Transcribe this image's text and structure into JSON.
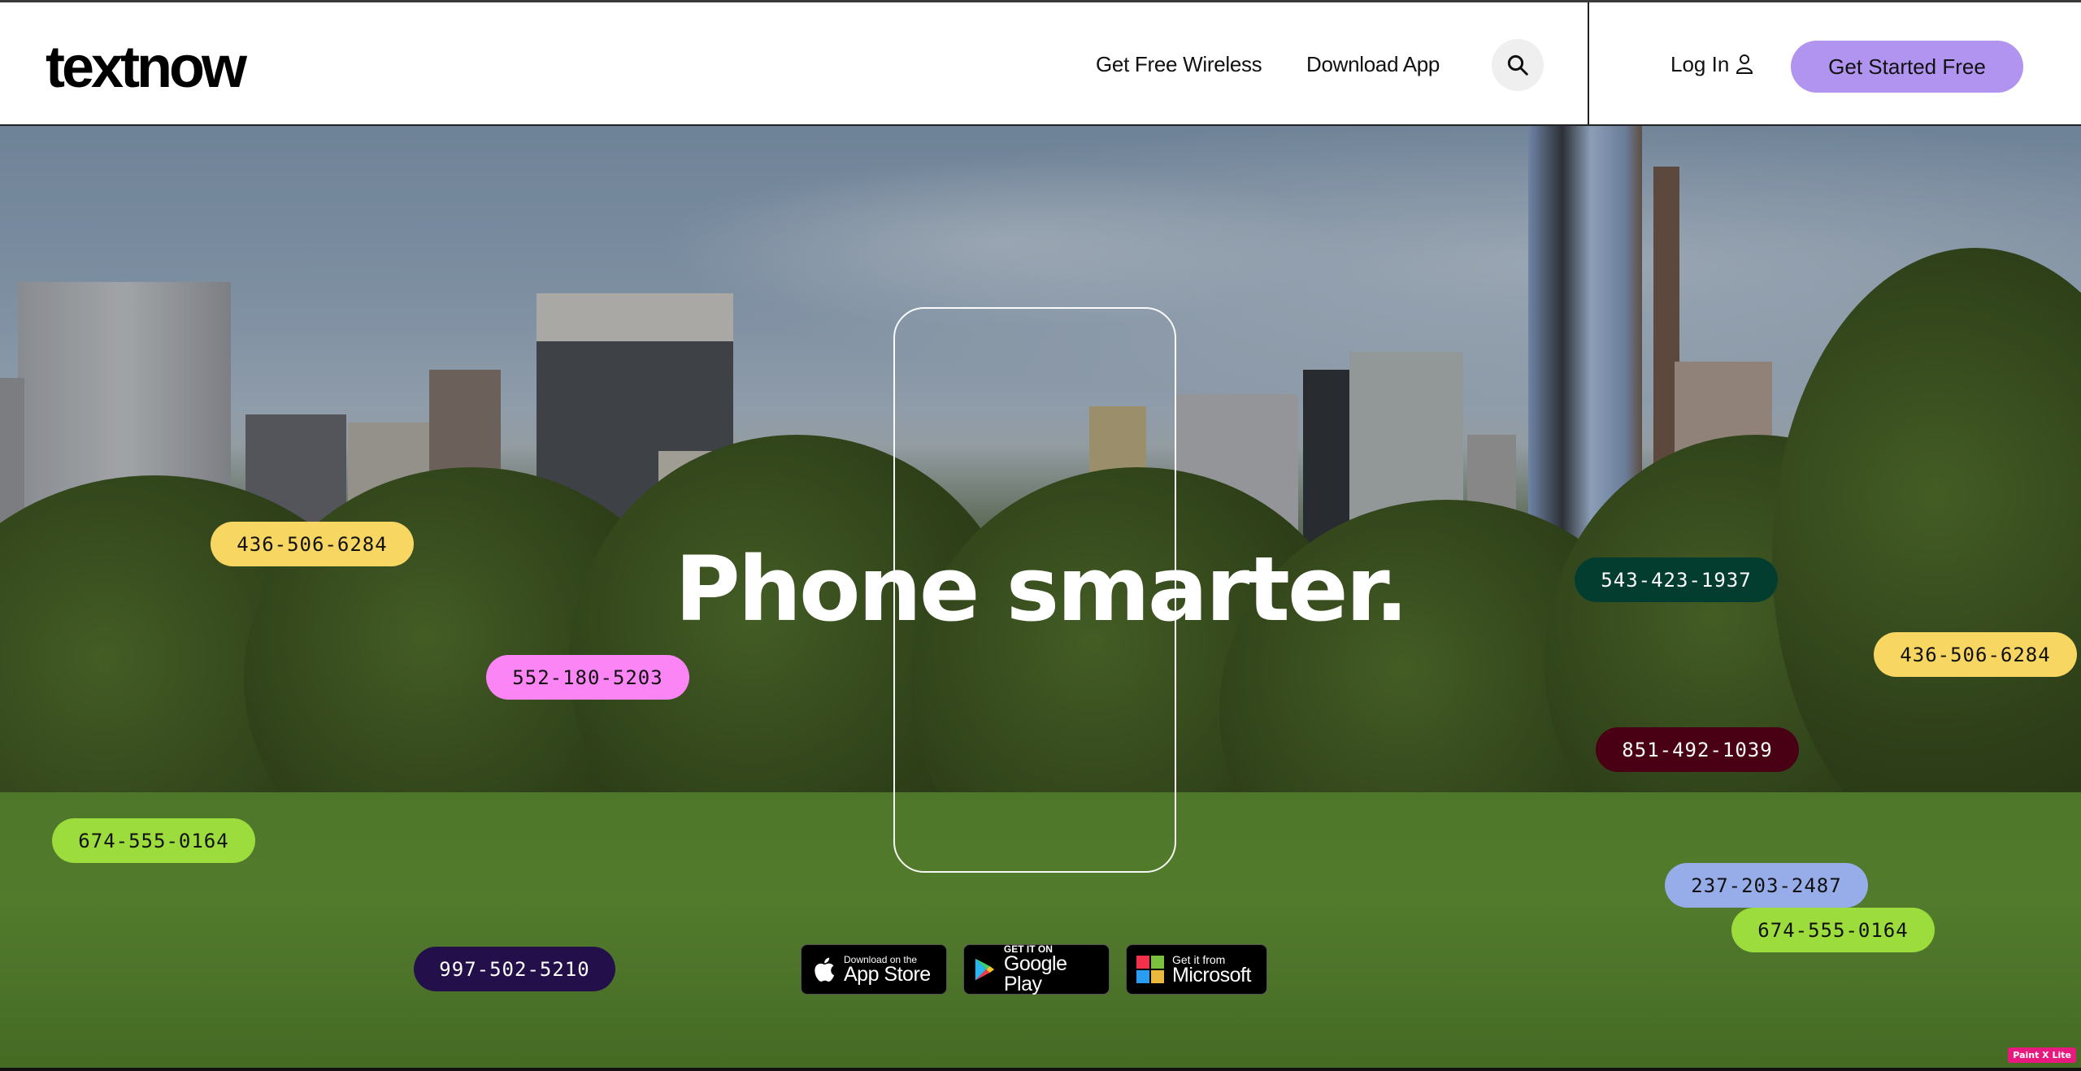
{
  "header": {
    "logo": "textnow",
    "nav": [
      {
        "label": "Get Free Wireless"
      },
      {
        "label": "Download App"
      }
    ],
    "search_icon": "search-icon",
    "login_label": "Log In",
    "login_icon": "user-icon",
    "cta_label": "Get Started Free",
    "cta_color": "#b094f0"
  },
  "hero": {
    "headline": "Phone smarter.",
    "badges": [
      {
        "number": "436-506-6284",
        "bg": "#f8d662",
        "fg": "#111111"
      },
      {
        "number": "552-180-5203",
        "bg": "#fb85f5",
        "fg": "#111111"
      },
      {
        "number": "674-555-0164",
        "bg": "#9cdc3c",
        "fg": "#111111"
      },
      {
        "number": "997-502-5210",
        "bg": "#23104a",
        "fg": "#ffffff"
      },
      {
        "number": "543-423-1937",
        "bg": "#033d30",
        "fg": "#ffffff"
      },
      {
        "number": "436-506-6284",
        "bg": "#f8d662",
        "fg": "#111111"
      },
      {
        "number": "851-492-1039",
        "bg": "#4a0014",
        "fg": "#ffffff"
      },
      {
        "number": "237-203-2487",
        "bg": "#97ade9",
        "fg": "#111111"
      },
      {
        "number": "674-555-0164",
        "bg": "#9cdc3c",
        "fg": "#111111"
      }
    ],
    "stores": [
      {
        "small": "Download on the",
        "big": "App Store",
        "icon": "apple-icon"
      },
      {
        "small": "GET IT ON",
        "big": "Google Play",
        "icon": "google-play-icon"
      },
      {
        "small": "Get it from",
        "big": "Microsoft",
        "icon": "microsoft-icon"
      }
    ]
  },
  "watermark": "Paint X Lite"
}
